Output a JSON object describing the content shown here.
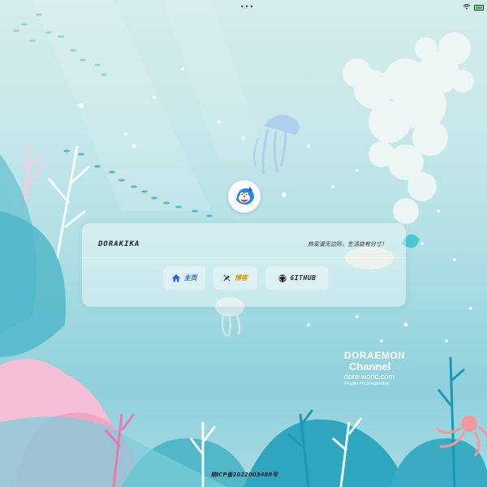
{
  "status_bar": {
    "center_dots": "•••"
  },
  "profile": {
    "name": "DORAKIKA",
    "motto": "热爱漫无边际，生活自有分寸！"
  },
  "nav": {
    "home": {
      "label": "主页",
      "icon": "home-icon",
      "color": "#2364d8"
    },
    "blog": {
      "label": "博客",
      "icon": "blog-icon",
      "color": "#d49b10"
    },
    "github": {
      "label": "GITHUB",
      "icon": "github-icon",
      "color": "#1c1f33"
    }
  },
  "footer": {
    "icp": "皖ICP备2022003488号"
  },
  "watermark": {
    "line1": "DORAEMON",
    "line2": "Channel",
    "site": "dora-world.com",
    "copyright": "©Fujiko-Pro,Shogakukan"
  }
}
